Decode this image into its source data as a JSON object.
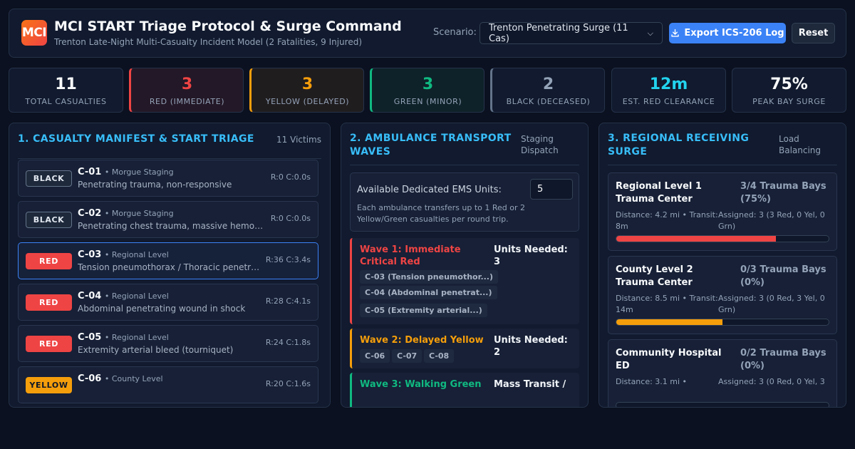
{
  "header": {
    "logo": "MCI",
    "title": "MCI START Triage Protocol & Surge Command",
    "subtitle": "Trenton Late-Night Multi-Casualty Incident Model (2 Fatalities, 9 Injured)",
    "scenario_label": "Scenario:",
    "scenario_value": "Trenton Penetrating Surge (11 Cas)",
    "export_label": "Export ICS-206 Log",
    "reset_label": "Reset"
  },
  "stats": [
    {
      "value": "11",
      "label": "TOTAL CASUALTIES",
      "color": "#f8fafc"
    },
    {
      "value": "3",
      "label": "RED (IMMEDIATE)",
      "color": "#ef4444"
    },
    {
      "value": "3",
      "label": "YELLOW (DELAYED)",
      "color": "#f59e0b"
    },
    {
      "value": "3",
      "label": "GREEN (MINOR)",
      "color": "#10b981"
    },
    {
      "value": "2",
      "label": "BLACK (DECEASED)",
      "color": "#94a3b8"
    },
    {
      "value": "12m",
      "label": "EST. RED CLEARANCE",
      "color": "#22d3ee"
    },
    {
      "value": "75%",
      "label": "PEAK BAY SURGE",
      "color": "#f8fafc"
    }
  ],
  "manifest": {
    "title": "1. CASUALTY MANIFEST & START TRIAGE",
    "count_label": "11 Victims",
    "casualties": [
      {
        "tag": "BLACK",
        "id": "C-01",
        "location": "• Morgue Staging",
        "description": "Penetrating trauma, non-responsive",
        "stats": "R:0  C:0.0s"
      },
      {
        "tag": "BLACK",
        "id": "C-02",
        "location": "• Morgue Staging",
        "description": "Penetrating chest trauma, massive hemorrhage",
        "stats": "R:0  C:0.0s"
      },
      {
        "tag": "RED",
        "id": "C-03",
        "location": "• Regional Level",
        "description": "Tension pneumothorax / Thoracic penetrating",
        "stats": "R:36  C:3.4s"
      },
      {
        "tag": "RED",
        "id": "C-04",
        "location": "• Regional Level",
        "description": "Abdominal penetrating wound in shock",
        "stats": "R:28  C:4.1s"
      },
      {
        "tag": "RED",
        "id": "C-05",
        "location": "• Regional Level",
        "description": "Extremity arterial bleed (tourniquet)",
        "stats": "R:24  C:1.8s"
      },
      {
        "tag": "YELLOW",
        "id": "C-06",
        "location": "• County Level",
        "description": "",
        "stats": "R:20  C:1.6s"
      }
    ]
  },
  "transport": {
    "title": "2. AMBULANCE TRANSPORT WAVES",
    "side_label": "Staging Dispatch",
    "units_label": "Available Dedicated EMS Units:",
    "units_value": "5",
    "units_note": "Each ambulance transfers up to 1 Red or 2 Yellow/Green casualties per round trip.",
    "waves": [
      {
        "name": "Wave 1: Immediate Critical Red",
        "need": "Units Needed: 3",
        "chips": [
          "C-03 (Tension pneumothor...)",
          "C-04 (Abdominal penetrat...)",
          "C-05 (Extremity arterial...)"
        ]
      },
      {
        "name": "Wave 2: Delayed Yellow",
        "need": "Units Needed: 2",
        "chips": [
          "C-06",
          "C-07",
          "C-08"
        ]
      },
      {
        "name": "Wave 3: Walking Green",
        "need": "Mass Transit /",
        "chips": []
      }
    ]
  },
  "surge": {
    "title": "3. REGIONAL RECEIVING SURGE",
    "side_label": "Load Balancing",
    "facilities": [
      {
        "name": "Regional Level 1 Trauma Center",
        "bays": "3/4 Trauma Bays (75%)",
        "distance": "Distance: 4.2 mi • Transit: 8m",
        "assigned": "Assigned: 3 (3 Red, 0 Yel, 0 Grn)",
        "load": 0.75,
        "color": "#ef4444"
      },
      {
        "name": "County Level 2 Trauma Center",
        "bays": "0/3 Trauma Bays (0%)",
        "distance": "Distance: 8.5 mi • Transit: 14m",
        "assigned": "Assigned: 3 (0 Red, 3 Yel, 0 Grn)",
        "load": 0.5,
        "color": "#f59e0b"
      },
      {
        "name": "Community Hospital ED",
        "bays": "0/2 Trauma Bays (0%)",
        "distance": "Distance: 3.1 mi •",
        "assigned": "Assigned: 3 (0 Red, 0 Yel, 3",
        "load": 0.0,
        "color": "#10b981"
      }
    ]
  }
}
